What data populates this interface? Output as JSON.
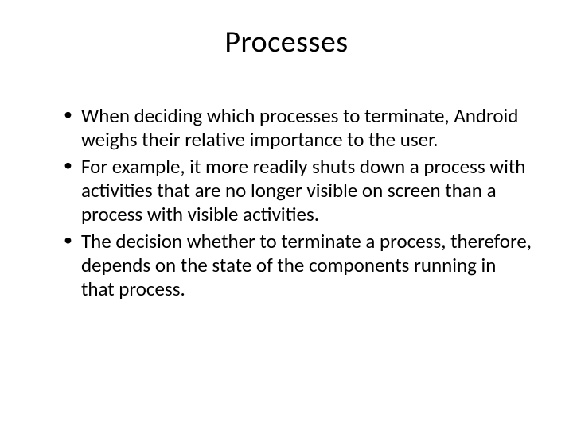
{
  "slide": {
    "title": "Processes",
    "bullets": [
      "When deciding which processes to terminate, Android weighs their relative importance to the user.",
      "For example, it more readily shuts down a process with activities that are no longer visible on screen than a process with visible activities.",
      "The decision whether to terminate a process, therefore, depends on the state of the components running in that process."
    ]
  }
}
